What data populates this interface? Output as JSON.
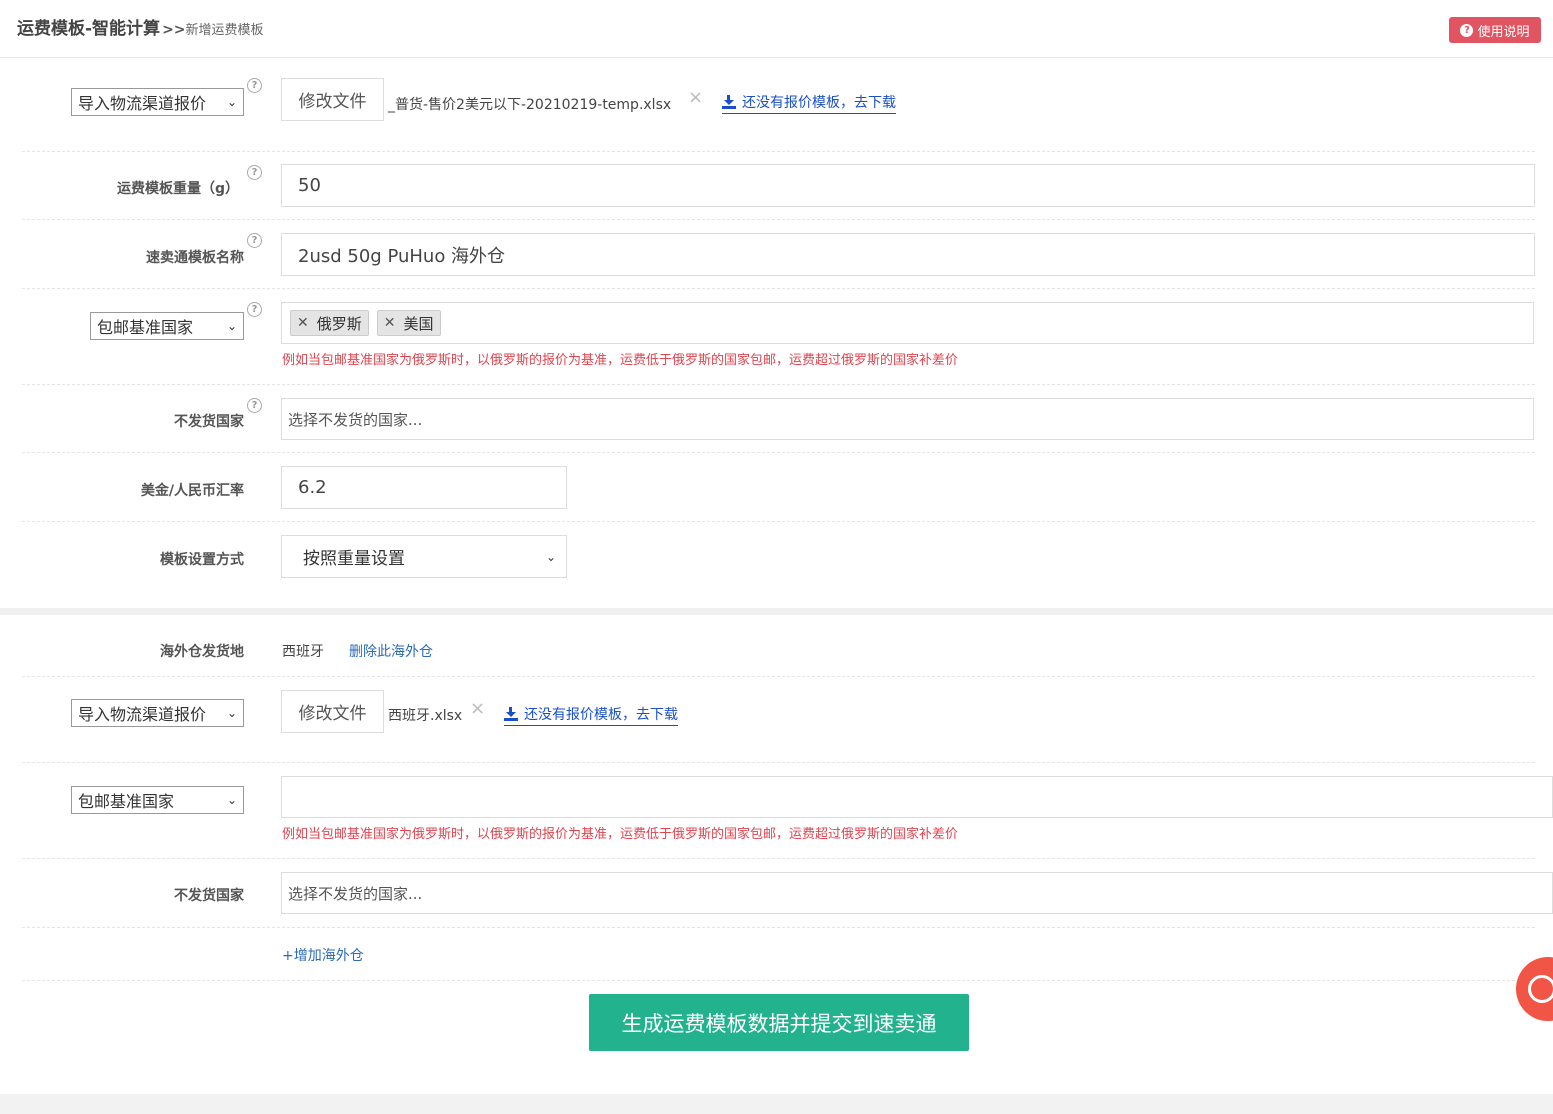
{
  "header": {
    "title": "运费模板-智能计算",
    "separator": ">>",
    "subtitle": "新增运费模板",
    "help_label": "使用说明"
  },
  "section1": {
    "import_select": "导入物流渠道报价",
    "modify_file_label": "修改文件",
    "file_name": "_普货-售价2美元以下-20210219-temp.xlsx",
    "download_link": "还没有报价模板，去下载",
    "weight_label": "运费模板重量（g）",
    "weight_value": "50",
    "name_label": "速卖通模板名称",
    "name_value": "2usd 50g PuHuo 海外仓",
    "base_country_select": "包邮基准国家",
    "base_countries": [
      "俄罗斯",
      "美国"
    ],
    "base_country_hint": "例如当包邮基准国家为俄罗斯时，以俄罗斯的报价为基准，运费低于俄罗斯的国家包邮，运费超过俄罗斯的国家补差价",
    "no_ship_label": "不发货国家",
    "no_ship_placeholder": "选择不发货的国家...",
    "rate_label": "美金/人民币汇率",
    "rate_value": "6.2",
    "mode_label": "模板设置方式",
    "mode_value": "按照重量设置"
  },
  "section2": {
    "warehouse_label": "海外仓发货地",
    "warehouse_value": "西班牙",
    "delete_link": "删除此海外仓",
    "import_select": "导入物流渠道报价",
    "modify_file_label": "修改文件",
    "file_name": "西班牙.xlsx",
    "download_link": "还没有报价模板，去下载",
    "base_country_select": "包邮基准国家",
    "base_country_hint": "例如当包邮基准国家为俄罗斯时，以俄罗斯的报价为基准，运费低于俄罗斯的国家包邮，运费超过俄罗斯的国家补差价",
    "no_ship_label": "不发货国家",
    "no_ship_placeholder": "选择不发货的国家...",
    "add_warehouse": "+增加海外仓"
  },
  "submit_label": "生成运费模板数据并提交到速卖通",
  "icons": {
    "question": "?",
    "close": "×",
    "tag_close": "✕",
    "chevron": "⌄"
  }
}
